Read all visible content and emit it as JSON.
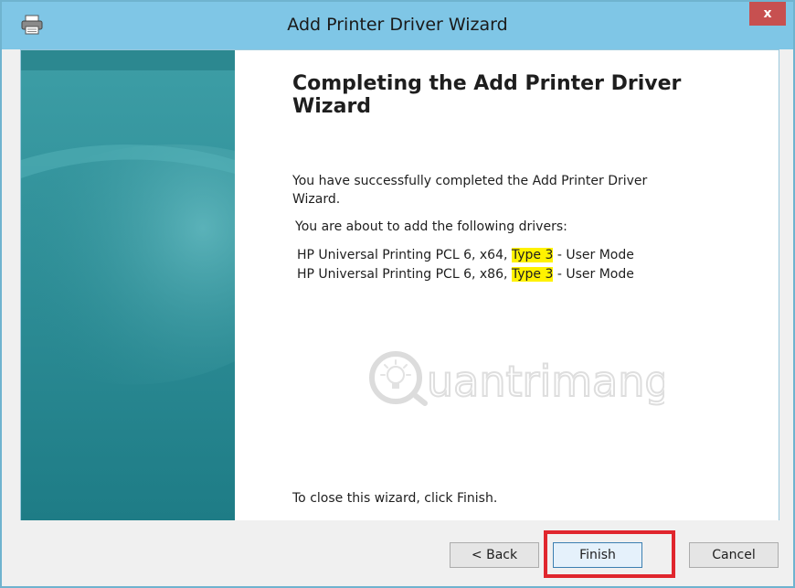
{
  "window": {
    "title": "Add Printer Driver Wizard",
    "close_label": "x"
  },
  "content": {
    "heading": "Completing the Add Printer Driver Wizard",
    "success_line1": "You have successfully completed the Add Printer Driver",
    "success_line2": "Wizard.",
    "intro": "You are about to add the following drivers:",
    "drivers": [
      {
        "prefix": "HP Universal Printing PCL 6, x64, ",
        "type": "Type 3",
        "suffix": " - User Mode"
      },
      {
        "prefix": "HP Universal Printing PCL 6, x86, ",
        "type": "Type 3",
        "suffix": " - User Mode"
      }
    ],
    "close_hint": "To close this wizard, click Finish."
  },
  "watermark": {
    "text": "uantrimang"
  },
  "buttons": {
    "back": "< Back",
    "finish": "Finish",
    "cancel": "Cancel"
  },
  "colors": {
    "titlebar": "#7fc6e6",
    "banner": "#2a8a92",
    "highlight_yellow": "#fff200",
    "annotation_red": "#e0262d"
  }
}
